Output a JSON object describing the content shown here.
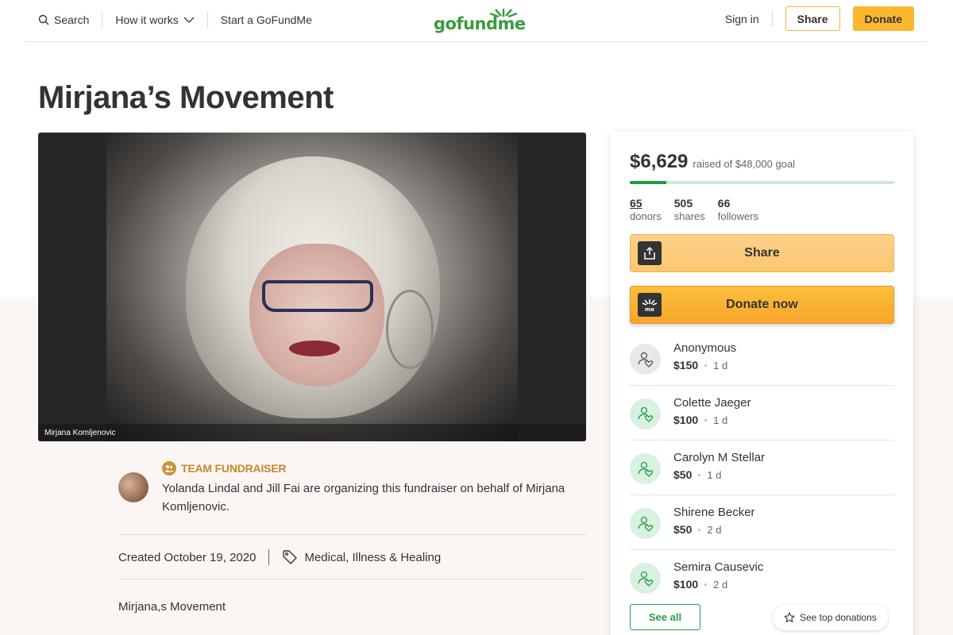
{
  "header": {
    "search_label": "Search",
    "how_it_works_label": "How it works",
    "start_label": "Start a GoFundMe",
    "logo_text": "gofundme",
    "signin_label": "Sign in",
    "share_label": "Share",
    "donate_label": "Donate"
  },
  "page": {
    "title": "Mirjana’s Movement"
  },
  "hero": {
    "caption": "Mirjana Komljenovic"
  },
  "organizer": {
    "badge": "TEAM FUNDRAISER",
    "text": "Yolanda Lindal and Jill Fai are organizing this fundraiser on behalf of Mirjana Komljenovic.",
    "created": "Created October 19, 2020",
    "category": "Medical, Illness & Healing",
    "story_start": "Mirjana,s Movement"
  },
  "card": {
    "raised": "$6,629",
    "raised_of": "raised of $48,000 goal",
    "progress": 0.138,
    "stats": [
      {
        "num": "65",
        "label": "donors"
      },
      {
        "num": "505",
        "label": "shares"
      },
      {
        "num": "66",
        "label": "followers"
      }
    ],
    "share_label": "Share",
    "donate_label": "Donate now",
    "donations": [
      {
        "name": "Anonymous",
        "amount": "$150",
        "time": "1 d"
      },
      {
        "name": "Colette Jaeger",
        "amount": "$100",
        "time": "1 d"
      },
      {
        "name": "Carolyn M Stellar",
        "amount": "$50",
        "time": "1 d"
      },
      {
        "name": "Shirene Becker",
        "amount": "$50",
        "time": "2 d"
      },
      {
        "name": "Semira Causevic",
        "amount": "$100",
        "time": "2 d"
      }
    ],
    "see_all_label": "See all",
    "see_top_label": "See top donations"
  },
  "colors": {
    "brand_green": "#3a9b3c",
    "donate_yellow": "#fbb730",
    "team_gold": "#c18a2f"
  }
}
